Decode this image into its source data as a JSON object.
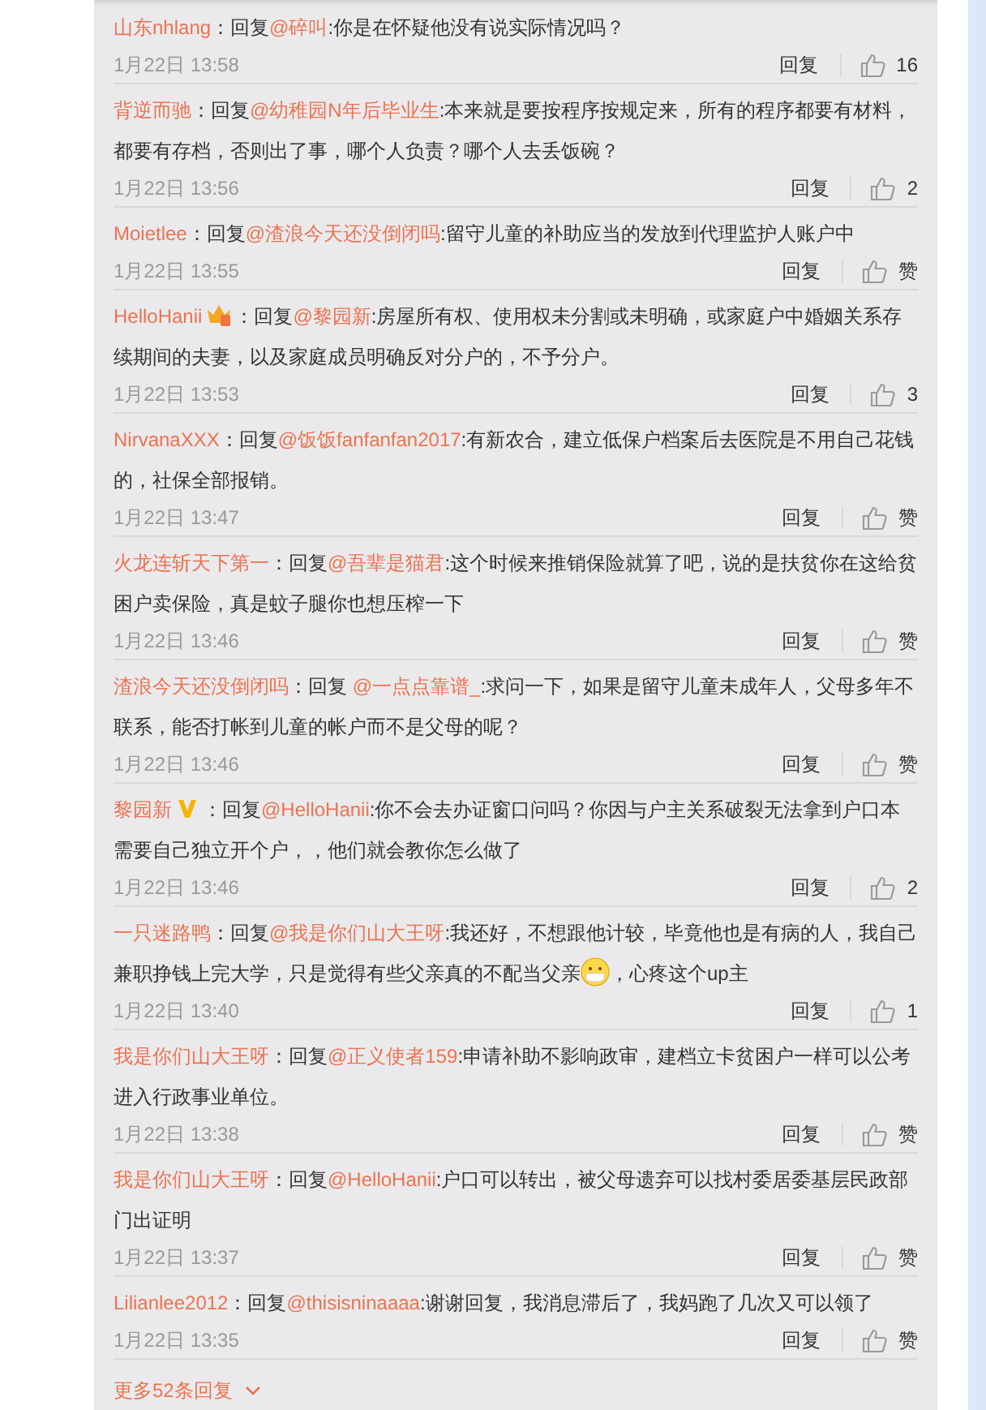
{
  "comments": [
    {
      "user": "山东nhlang",
      "vip": false,
      "verified": false,
      "reply_word": "：回复",
      "mention": "@碎叫",
      "body": [
        {
          "kind": "text",
          "text": ":你是在怀疑他没有说实际情况吗？"
        }
      ],
      "date": "1月22日 13:58",
      "reply_button": "回复",
      "likes": "16"
    },
    {
      "user": "背逆而驰",
      "vip": false,
      "verified": false,
      "reply_word": "：回复",
      "mention": "@幼稚园N年后毕业生",
      "body": [
        {
          "kind": "text",
          "text": ":本来就是要按程序按规定来，所有的程序都要有材料，都要有存档，否则出了事，哪个人负责？哪个人去丢饭碗？"
        }
      ],
      "date": "1月22日 13:56",
      "reply_button": "回复",
      "likes": "2"
    },
    {
      "user": "Moietlee",
      "vip": false,
      "verified": false,
      "reply_word": "：回复",
      "mention": "@渣浪今天还没倒闭吗",
      "body": [
        {
          "kind": "text",
          "text": ":留守儿童的补助应当的发放到代理监护人账户中"
        }
      ],
      "date": "1月22日 13:55",
      "reply_button": "回复",
      "likes": "赞"
    },
    {
      "user": "HelloHanii",
      "vip": true,
      "verified": false,
      "reply_word": "：回复",
      "mention": "@黎园新",
      "body": [
        {
          "kind": "text",
          "text": ":房屋所有权、使用权未分割或未明确，或家庭户中婚姻关系存续期间的夫妻，以及家庭成员明确反对分户的，不予分户。"
        }
      ],
      "date": "1月22日 13:53",
      "reply_button": "回复",
      "likes": "3"
    },
    {
      "user": "NirvanaXXX",
      "vip": false,
      "verified": false,
      "reply_word": "：回复",
      "mention": "@饭饭fanfanfan2017",
      "body": [
        {
          "kind": "text",
          "text": ":有新农合，建立低保户档案后去医院是不用自己花钱的，社保全部报销。"
        }
      ],
      "date": "1月22日 13:47",
      "reply_button": "回复",
      "likes": "赞"
    },
    {
      "user": "火龙连斩天下第一",
      "vip": false,
      "verified": false,
      "reply_word": "：回复",
      "mention": "@吾辈是猫君",
      "body": [
        {
          "kind": "text",
          "text": ":这个时候来推销保险就算了吧，说的是扶贫你在这给贫困户卖保险，真是蚊子腿你也想压榨一下"
        }
      ],
      "date": "1月22日 13:46",
      "reply_button": "回复",
      "likes": "赞"
    },
    {
      "user": "渣浪今天还没倒闭吗",
      "vip": false,
      "verified": false,
      "reply_word": "：回复 ",
      "mention": "@一点点靠谱_",
      "body": [
        {
          "kind": "text",
          "text": ":求问一下，如果是留守儿童未成年人，父母多年不联系，能否打帐到儿童的帐户而不是父母的呢？"
        }
      ],
      "date": "1月22日 13:46",
      "reply_button": "回复",
      "likes": "赞"
    },
    {
      "user": "黎园新",
      "vip": false,
      "verified": true,
      "reply_word": "：回复",
      "mention": "@HelloHanii",
      "body": [
        {
          "kind": "text",
          "text": ":你不会去办证窗口问吗？你因与户主关系破裂无法拿到户口本需要自己独立开个户，，他们就会教你怎么做了"
        }
      ],
      "date": "1月22日 13:46",
      "reply_button": "回复",
      "likes": "2"
    },
    {
      "user": "一只迷路鸭",
      "vip": false,
      "verified": false,
      "reply_word": "：回复",
      "mention": "@我是你们山大王呀",
      "body": [
        {
          "kind": "text",
          "text": ":我还好，不想跟他计较，毕竟他也是有病的人，我自己兼职挣钱上完大学，只是觉得有些父亲真的不配当父亲"
        },
        {
          "kind": "emoji"
        },
        {
          "kind": "text",
          "text": "，心疼这个up主"
        }
      ],
      "date": "1月22日 13:40",
      "reply_button": "回复",
      "likes": "1"
    },
    {
      "user": "我是你们山大王呀",
      "vip": false,
      "verified": false,
      "reply_word": "：回复",
      "mention": "@正义使者159",
      "body": [
        {
          "kind": "text",
          "text": ":申请补助不影响政审，建档立卡贫困户一样可以公考进入行政事业单位。"
        }
      ],
      "date": "1月22日 13:38",
      "reply_button": "回复",
      "likes": "赞"
    },
    {
      "user": "我是你们山大王呀",
      "vip": false,
      "verified": false,
      "reply_word": "：回复",
      "mention": "@HelloHanii",
      "body": [
        {
          "kind": "text",
          "text": ":户口可以转出，被父母遗弃可以找村委居委基层民政部门出证明"
        }
      ],
      "date": "1月22日 13:37",
      "reply_button": "回复",
      "likes": "赞"
    },
    {
      "user": "Lilianlee2012",
      "vip": false,
      "verified": false,
      "reply_word": "：回复",
      "mention": "@thisisninaaaa",
      "body": [
        {
          "kind": "text",
          "text": ":谢谢回复，我消息滞后了，我妈跑了几次又可以领了"
        }
      ],
      "date": "1月22日 13:35",
      "reply_button": "回复",
      "likes": "赞"
    }
  ],
  "more_link": "更多52条回复"
}
